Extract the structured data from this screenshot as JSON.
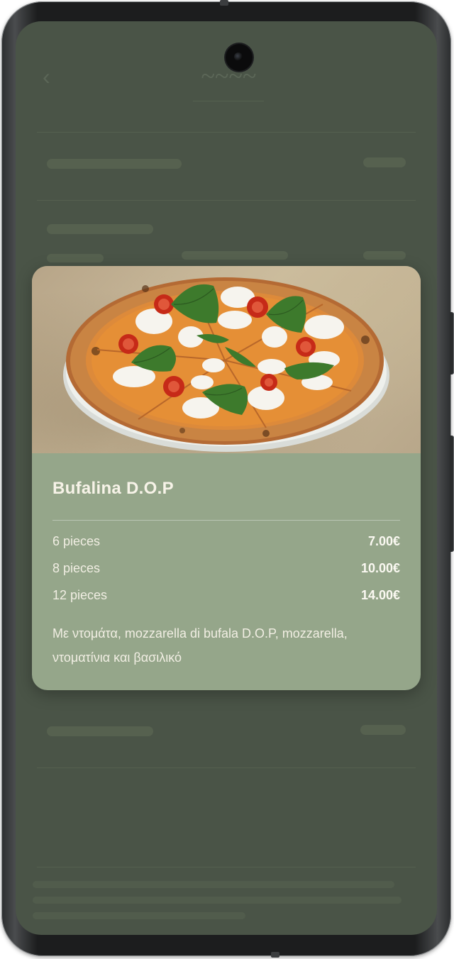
{
  "menu_item": {
    "title": "Bufalina D.O.P",
    "prices": [
      {
        "quantity": "6 pieces",
        "price": "7.00€"
      },
      {
        "quantity": "8 pieces",
        "price": "10.00€"
      },
      {
        "quantity": "12 pieces",
        "price": "14.00€"
      }
    ],
    "description": "Με ντομάτα, mozzarella di bufala D.O.P, mozzarella, ντοματίνια και βασιλικό"
  },
  "colors": {
    "card_background": "#95a68a",
    "screen_overlay": "#4a5447",
    "text": "#f4f1e6"
  },
  "icons": {
    "back": "chevron-left-icon",
    "camera": "front-camera-icon"
  }
}
